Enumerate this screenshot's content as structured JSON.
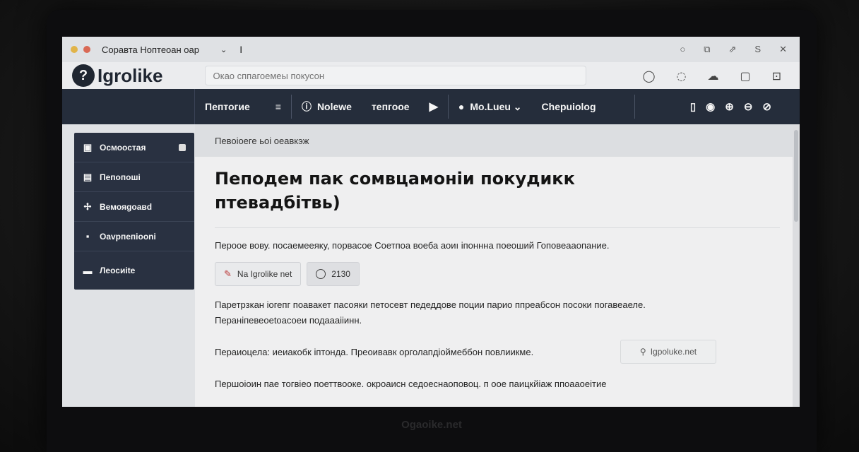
{
  "window": {
    "tab_title": "Соравта Ноптеоан оар",
    "tab_chevron": "⌄",
    "cursor": "I",
    "controls": [
      "○",
      "⧉",
      "⇗",
      "S",
      "✕"
    ]
  },
  "header": {
    "logo_mark": "?",
    "logo_text": "Igrolike",
    "search_placeholder": "Окао сппагоемеы покусон",
    "icons": [
      "chat-icon",
      "bubble-icon",
      "cloud-icon",
      "save-icon",
      "grid-icon"
    ],
    "icon_glyphs": [
      "◯",
      "◌",
      "☁",
      "▢",
      "⊡"
    ]
  },
  "nav": {
    "items": [
      {
        "label": "Пептогие",
        "icon": "≡"
      },
      {
        "label": "Nolewe",
        "icon": "ⓘ"
      },
      {
        "label": "тепгооe",
        "icon": ""
      },
      {
        "label": "",
        "icon": "▶"
      },
      {
        "label": "Мо.Lueu ⌄",
        "icon": "●"
      },
      {
        "label": "Chepuiolog",
        "icon": ""
      }
    ],
    "right_icons": [
      "▯",
      "◉",
      "⊕",
      "⊖",
      "⊘"
    ]
  },
  "sidebar": {
    "items": [
      {
        "label": "Осмоостая",
        "icon": "▣",
        "badge": true
      },
      {
        "label": "Пепопоші",
        "icon": "▤",
        "badge": false
      },
      {
        "label": "Вемояgоавd",
        "icon": "✢",
        "badge": false
      },
      {
        "label": "Оаvрпепіооnі",
        "icon": "▪",
        "badge": false
      },
      {
        "label": "Леосиіtе",
        "icon": "▬",
        "badge": false
      }
    ]
  },
  "main": {
    "breadcrumb": "Певоіоеге ьоі оеавкэж",
    "title": "Пеподем пак сомвцамоніи покудикк птевадбітвь)",
    "para1": "Пероое вову. посаемееяку, порвасое Соетпоа воеба аоиı іпоннна поеоший Гоповеааопание.",
    "chip1_label": "Na Igrolike net",
    "chip1_icon": "✎",
    "chip2_label": "2130",
    "para2_line1": "Паретрзкан іогепг поавакет пасояки петосевт педеддове поции парио ппреабсон посоки погавеаеле.",
    "para2_line2": "Пераніпевеоеtоасоеи подаааііинн.",
    "para3": "Пераиоцела: иеиакобк іптонда. Преоивавк орголапдіоймеббон повлиикме.",
    "link_chip_icon": "⚲",
    "link_chip_label": "Igpoluke.net",
    "para4": "Першоіоин пае тогвіео поеттвооке. окроаисн седоеснаоповоц. п оое паицкйіаж ппоааоеітиe"
  },
  "bezel_logo": "Ogaoike.net"
}
